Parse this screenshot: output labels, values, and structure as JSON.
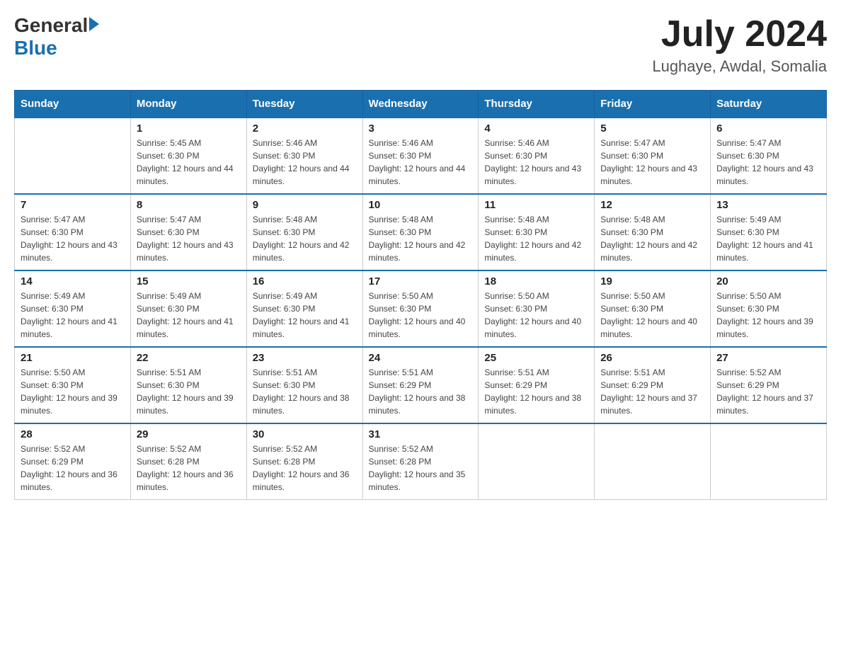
{
  "logo": {
    "text_general": "General",
    "text_blue": "Blue"
  },
  "title": {
    "month_year": "July 2024",
    "location": "Lughaye, Awdal, Somalia"
  },
  "headers": [
    "Sunday",
    "Monday",
    "Tuesday",
    "Wednesday",
    "Thursday",
    "Friday",
    "Saturday"
  ],
  "weeks": [
    {
      "days": [
        {
          "num": "",
          "sunrise": "",
          "sunset": "",
          "daylight": ""
        },
        {
          "num": "1",
          "sunrise": "Sunrise: 5:45 AM",
          "sunset": "Sunset: 6:30 PM",
          "daylight": "Daylight: 12 hours and 44 minutes."
        },
        {
          "num": "2",
          "sunrise": "Sunrise: 5:46 AM",
          "sunset": "Sunset: 6:30 PM",
          "daylight": "Daylight: 12 hours and 44 minutes."
        },
        {
          "num": "3",
          "sunrise": "Sunrise: 5:46 AM",
          "sunset": "Sunset: 6:30 PM",
          "daylight": "Daylight: 12 hours and 44 minutes."
        },
        {
          "num": "4",
          "sunrise": "Sunrise: 5:46 AM",
          "sunset": "Sunset: 6:30 PM",
          "daylight": "Daylight: 12 hours and 43 minutes."
        },
        {
          "num": "5",
          "sunrise": "Sunrise: 5:47 AM",
          "sunset": "Sunset: 6:30 PM",
          "daylight": "Daylight: 12 hours and 43 minutes."
        },
        {
          "num": "6",
          "sunrise": "Sunrise: 5:47 AM",
          "sunset": "Sunset: 6:30 PM",
          "daylight": "Daylight: 12 hours and 43 minutes."
        }
      ]
    },
    {
      "days": [
        {
          "num": "7",
          "sunrise": "Sunrise: 5:47 AM",
          "sunset": "Sunset: 6:30 PM",
          "daylight": "Daylight: 12 hours and 43 minutes."
        },
        {
          "num": "8",
          "sunrise": "Sunrise: 5:47 AM",
          "sunset": "Sunset: 6:30 PM",
          "daylight": "Daylight: 12 hours and 43 minutes."
        },
        {
          "num": "9",
          "sunrise": "Sunrise: 5:48 AM",
          "sunset": "Sunset: 6:30 PM",
          "daylight": "Daylight: 12 hours and 42 minutes."
        },
        {
          "num": "10",
          "sunrise": "Sunrise: 5:48 AM",
          "sunset": "Sunset: 6:30 PM",
          "daylight": "Daylight: 12 hours and 42 minutes."
        },
        {
          "num": "11",
          "sunrise": "Sunrise: 5:48 AM",
          "sunset": "Sunset: 6:30 PM",
          "daylight": "Daylight: 12 hours and 42 minutes."
        },
        {
          "num": "12",
          "sunrise": "Sunrise: 5:48 AM",
          "sunset": "Sunset: 6:30 PM",
          "daylight": "Daylight: 12 hours and 42 minutes."
        },
        {
          "num": "13",
          "sunrise": "Sunrise: 5:49 AM",
          "sunset": "Sunset: 6:30 PM",
          "daylight": "Daylight: 12 hours and 41 minutes."
        }
      ]
    },
    {
      "days": [
        {
          "num": "14",
          "sunrise": "Sunrise: 5:49 AM",
          "sunset": "Sunset: 6:30 PM",
          "daylight": "Daylight: 12 hours and 41 minutes."
        },
        {
          "num": "15",
          "sunrise": "Sunrise: 5:49 AM",
          "sunset": "Sunset: 6:30 PM",
          "daylight": "Daylight: 12 hours and 41 minutes."
        },
        {
          "num": "16",
          "sunrise": "Sunrise: 5:49 AM",
          "sunset": "Sunset: 6:30 PM",
          "daylight": "Daylight: 12 hours and 41 minutes."
        },
        {
          "num": "17",
          "sunrise": "Sunrise: 5:50 AM",
          "sunset": "Sunset: 6:30 PM",
          "daylight": "Daylight: 12 hours and 40 minutes."
        },
        {
          "num": "18",
          "sunrise": "Sunrise: 5:50 AM",
          "sunset": "Sunset: 6:30 PM",
          "daylight": "Daylight: 12 hours and 40 minutes."
        },
        {
          "num": "19",
          "sunrise": "Sunrise: 5:50 AM",
          "sunset": "Sunset: 6:30 PM",
          "daylight": "Daylight: 12 hours and 40 minutes."
        },
        {
          "num": "20",
          "sunrise": "Sunrise: 5:50 AM",
          "sunset": "Sunset: 6:30 PM",
          "daylight": "Daylight: 12 hours and 39 minutes."
        }
      ]
    },
    {
      "days": [
        {
          "num": "21",
          "sunrise": "Sunrise: 5:50 AM",
          "sunset": "Sunset: 6:30 PM",
          "daylight": "Daylight: 12 hours and 39 minutes."
        },
        {
          "num": "22",
          "sunrise": "Sunrise: 5:51 AM",
          "sunset": "Sunset: 6:30 PM",
          "daylight": "Daylight: 12 hours and 39 minutes."
        },
        {
          "num": "23",
          "sunrise": "Sunrise: 5:51 AM",
          "sunset": "Sunset: 6:30 PM",
          "daylight": "Daylight: 12 hours and 38 minutes."
        },
        {
          "num": "24",
          "sunrise": "Sunrise: 5:51 AM",
          "sunset": "Sunset: 6:29 PM",
          "daylight": "Daylight: 12 hours and 38 minutes."
        },
        {
          "num": "25",
          "sunrise": "Sunrise: 5:51 AM",
          "sunset": "Sunset: 6:29 PM",
          "daylight": "Daylight: 12 hours and 38 minutes."
        },
        {
          "num": "26",
          "sunrise": "Sunrise: 5:51 AM",
          "sunset": "Sunset: 6:29 PM",
          "daylight": "Daylight: 12 hours and 37 minutes."
        },
        {
          "num": "27",
          "sunrise": "Sunrise: 5:52 AM",
          "sunset": "Sunset: 6:29 PM",
          "daylight": "Daylight: 12 hours and 37 minutes."
        }
      ]
    },
    {
      "days": [
        {
          "num": "28",
          "sunrise": "Sunrise: 5:52 AM",
          "sunset": "Sunset: 6:29 PM",
          "daylight": "Daylight: 12 hours and 36 minutes."
        },
        {
          "num": "29",
          "sunrise": "Sunrise: 5:52 AM",
          "sunset": "Sunset: 6:28 PM",
          "daylight": "Daylight: 12 hours and 36 minutes."
        },
        {
          "num": "30",
          "sunrise": "Sunrise: 5:52 AM",
          "sunset": "Sunset: 6:28 PM",
          "daylight": "Daylight: 12 hours and 36 minutes."
        },
        {
          "num": "31",
          "sunrise": "Sunrise: 5:52 AM",
          "sunset": "Sunset: 6:28 PM",
          "daylight": "Daylight: 12 hours and 35 minutes."
        },
        {
          "num": "",
          "sunrise": "",
          "sunset": "",
          "daylight": ""
        },
        {
          "num": "",
          "sunrise": "",
          "sunset": "",
          "daylight": ""
        },
        {
          "num": "",
          "sunrise": "",
          "sunset": "",
          "daylight": ""
        }
      ]
    }
  ]
}
